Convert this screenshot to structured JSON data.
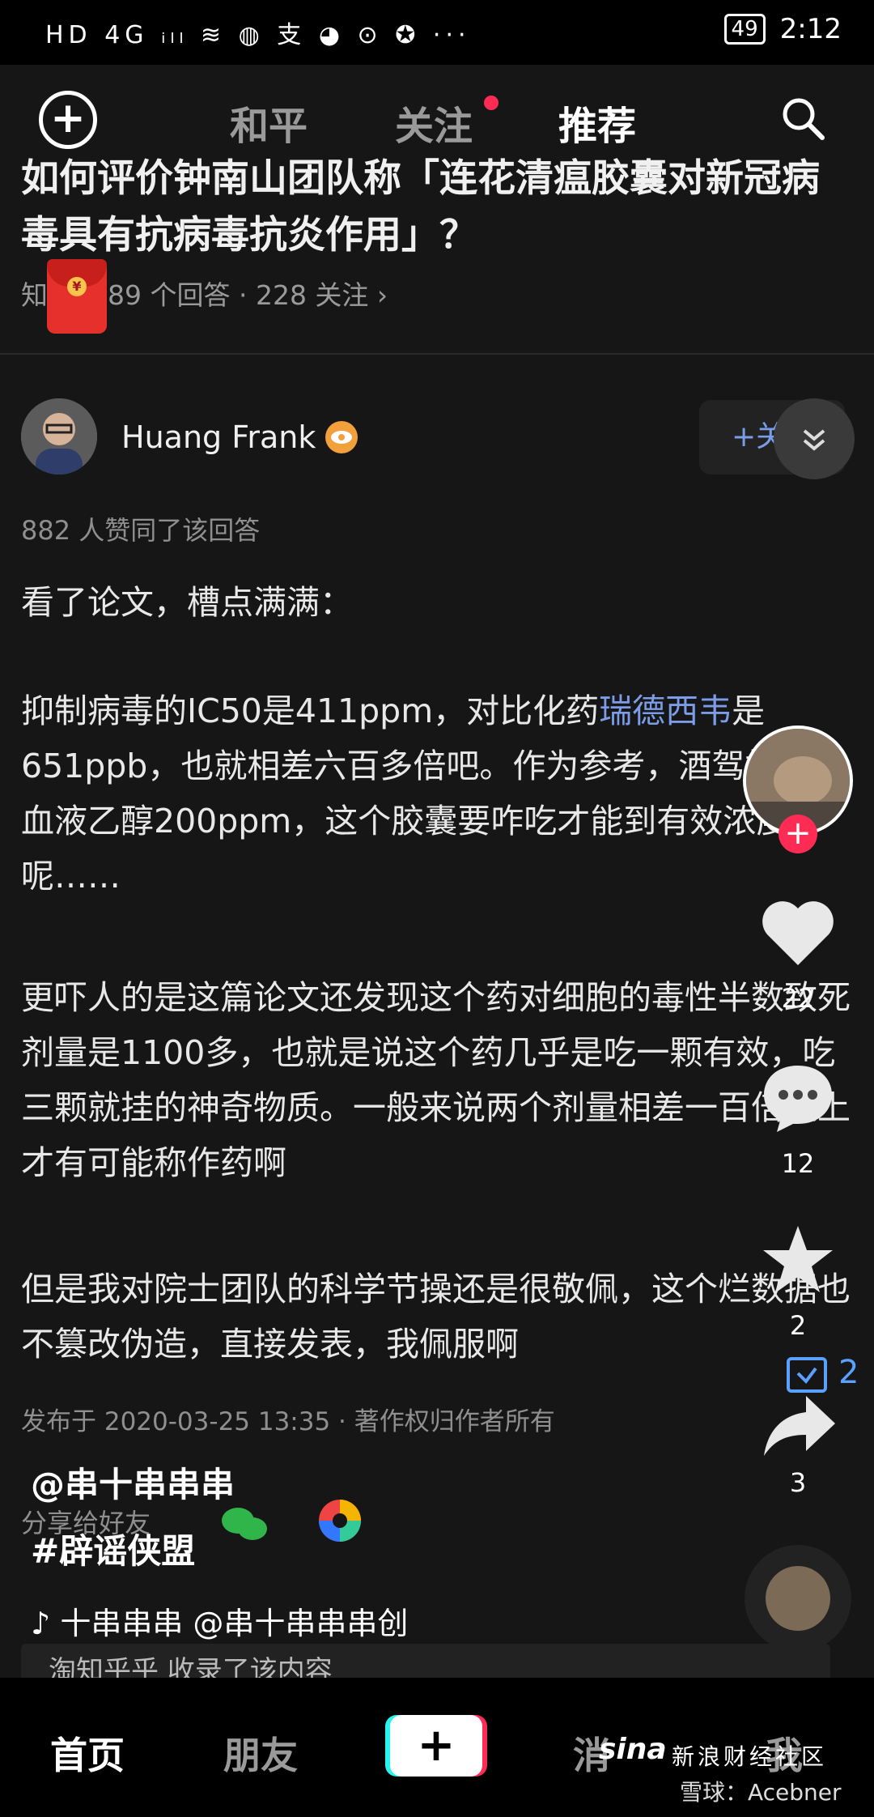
{
  "status_bar": {
    "left": "HD 4G ᵢₗₗ ≋ ◍ 支 ◕ ⊙ ✪ ···",
    "battery": "49",
    "time": "2:12"
  },
  "top_nav": {
    "tabs": [
      "和平",
      "关注",
      "推荐"
    ]
  },
  "question": {
    "title": "如何评价钟南山团队称「连花清瘟胶囊对新冠病毒具有抗病毒抗炎作用」？",
    "meta_prefix": "知",
    "meta": "89 个回答 · 228 关注 ›"
  },
  "author": {
    "name": "Huang Frank",
    "follow": "+关"
  },
  "likes_line": "882 人赞同了该回答",
  "paragraphs": {
    "p1": "看了论文，槽点满满：",
    "p2_before": "抑制病毒的IC50是411ppm，对比化药",
    "p2_link": "瑞德西韦",
    "p2_after": "是651ppb，也就相差六百多倍吧。作为参考，酒驾标准是血液乙醇200ppm，这个胶囊要咋吃才能到有效浓度呢……",
    "p3": "更吓人的是这篇论文还发现这个药对细胞的毒性半数致死剂量是1100多，也就是说这个药几乎是吃一颗有效，吃三颗就挂的神奇物质。一般来说两个剂量相差一百倍以上才有可能称作药啊",
    "p4": "但是我对院士团队的科学节操还是很敬佩，这个烂数据也不篡改伪造，直接发表，我佩服啊"
  },
  "posted": "发布于 2020-03-25 13:35 · 著作权归作者所有",
  "share_label": "分享给好友",
  "captions": {
    "user": "@串十串串串",
    "tag": "#辟谣侠盟",
    "music": "十串串串  @串十串串串创"
  },
  "collected": "淘知乎乎 收录了该内容",
  "rail": {
    "likes": "22",
    "comments": "12",
    "favorites": "2",
    "shares": "3",
    "small_count": "2"
  },
  "bottom_nav": {
    "home": "首页",
    "friends": "朋友",
    "create": "+",
    "messages": "消",
    "me": "我"
  },
  "watermark": {
    "logo": "sina",
    "line1": "新浪财经社区",
    "line2": "雪球：Acebner"
  }
}
